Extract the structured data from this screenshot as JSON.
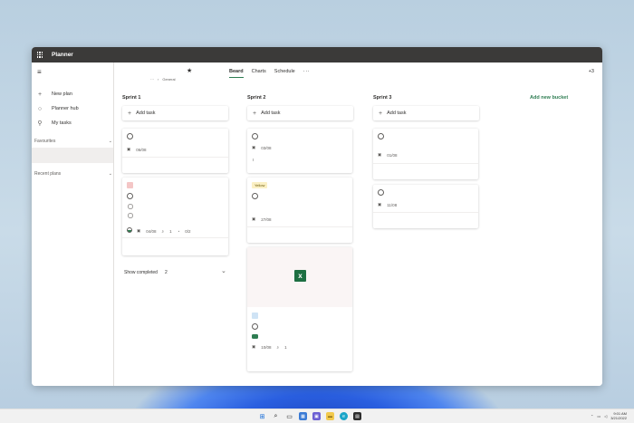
{
  "window": {
    "title": "Planner"
  },
  "sidebar": {
    "items": [
      {
        "label": "New plan",
        "icon": "plus-icon"
      },
      {
        "label": "Planner hub",
        "icon": "circle-icon"
      },
      {
        "label": "My tasks",
        "icon": "person-icon"
      }
    ],
    "favourites_label": "Favourites",
    "recent_label": "Recent plans"
  },
  "plan": {
    "breadcrumb_more": "···",
    "breadcrumb_sep": "›",
    "breadcrumb_group": "General"
  },
  "tabs": [
    {
      "label": "Beard",
      "active": true
    },
    {
      "label": "Charts",
      "active": false
    },
    {
      "label": "Schedule",
      "active": false
    }
  ],
  "tabs_more": "···",
  "share_label": "+3",
  "add_task_label": "Add task",
  "add_bucket_label": "Add new bucket",
  "show_completed": {
    "label": "Show completed",
    "count": "2"
  },
  "buckets": [
    {
      "name": "Sprint 1",
      "cards": [
        {
          "date": "06/08"
        },
        {
          "date": "04/08",
          "attachments": "1",
          "checklist": "0/2"
        }
      ]
    },
    {
      "name": "Sprint 2",
      "cards": [
        {
          "date": "03/08",
          "note": "I"
        },
        {
          "tag": "Yellow",
          "date": "27/08"
        },
        {
          "preview_icon": "excel-icon",
          "date": "10/08",
          "attachments": "1"
        }
      ]
    },
    {
      "name": "Sprint 3",
      "cards": [
        {
          "date": "01/08"
        },
        {
          "date": "11/08"
        }
      ]
    }
  ],
  "taskbar": {
    "icons": [
      "windows-icon",
      "search-icon",
      "task-view-icon",
      "widgets-icon",
      "chat-icon",
      "file-explorer-icon",
      "edge-icon",
      "store-icon"
    ],
    "time": "9:01 AM",
    "date": "3/21/2022"
  }
}
